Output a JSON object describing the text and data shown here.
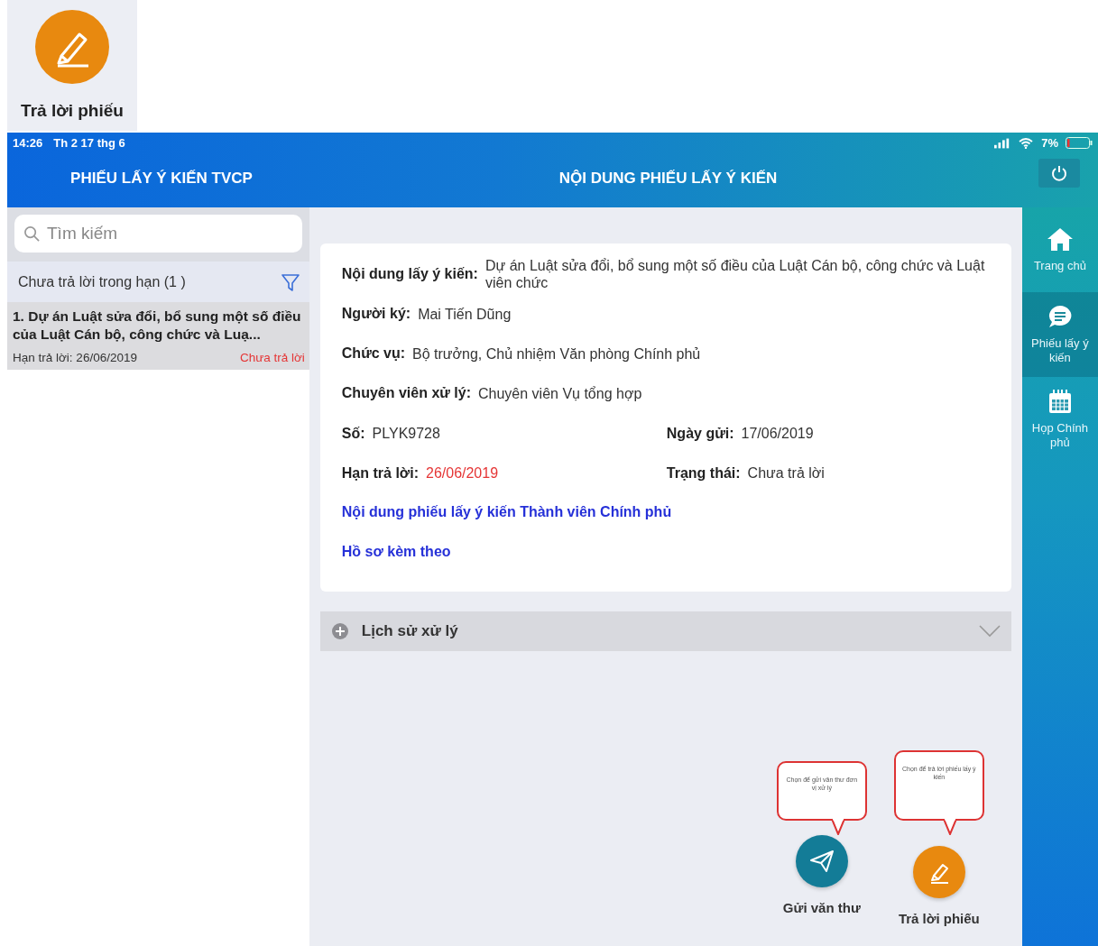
{
  "preview": {
    "label": "Trả lời phiếu"
  },
  "status_bar": {
    "time": "14:26",
    "date": "Th 2 17 thg 6",
    "battery": "7%"
  },
  "header": {
    "left_title": "PHIẾU LẤY Ý KIẾN TVCP",
    "title": "NỘI DUNG PHIẾU LẤY Ý KIẾN"
  },
  "search": {
    "placeholder": "Tìm kiếm"
  },
  "filter": {
    "label": "Chưa trả lời trong hạn (1 )"
  },
  "list": [
    {
      "title": "1. Dự án Luật sửa đổi, bổ sung một số điều của Luật Cán bộ, công chức và Luạ...",
      "deadline": "Hạn trả lời: 26/06/2019",
      "status": "Chưa trả lời",
      "selected": true
    }
  ],
  "details": {
    "rows": [
      {
        "fields": [
          {
            "label": "Nội dung lấy ý kiến:",
            "value": "Dự án Luật sửa đổi, bổ sung một số điều của Luật Cán bộ, công chức và Luật viên chức",
            "highlight": false
          }
        ]
      },
      {
        "fields": [
          {
            "label": "Người ký:",
            "value": "Mai Tiến Dũng",
            "highlight": false
          }
        ]
      },
      {
        "fields": [
          {
            "label": "Chức vụ:",
            "value": "Bộ trưởng, Chủ nhiệm Văn phòng Chính phủ",
            "highlight": false
          }
        ]
      },
      {
        "fields": [
          {
            "label": "Chuyên viên xử lý:",
            "value": "Chuyên viên Vụ tổng hợp",
            "highlight": false
          }
        ]
      },
      {
        "fields": [
          {
            "label": "Số:",
            "value": "PLYK9728",
            "highlight": false
          },
          {
            "label": "Ngày gửi:",
            "value": "17/06/2019",
            "highlight": false
          }
        ]
      },
      {
        "fields": [
          {
            "label": "Hạn trả lời:",
            "value": "26/06/2019",
            "highlight": true
          },
          {
            "label": "Trạng thái:",
            "value": "Chưa trả lời",
            "highlight": false
          }
        ]
      }
    ],
    "links": [
      "Nội dung phiếu lấy ý kiến Thành viên Chính phủ",
      "Hồ sơ kèm theo"
    ]
  },
  "history": {
    "label": "Lịch sử xử lý",
    "expanded": false
  },
  "actions": [
    {
      "kind": "send",
      "label": "Gửi văn thư",
      "tooltip": "Chọn để gửi văn thư đơn vị xử lý"
    },
    {
      "kind": "answer",
      "label": "Trả lời phiếu",
      "tooltip": "Chọn để trả lời phiếu lấy ý kiến"
    }
  ],
  "nav": [
    {
      "kind": "home",
      "label": "Trang chủ",
      "selected": false
    },
    {
      "kind": "chat",
      "label": "Phiếu lấy ý kiến",
      "selected": true
    },
    {
      "kind": "calendar",
      "label": "Họp Chính phủ",
      "selected": false
    }
  ]
}
